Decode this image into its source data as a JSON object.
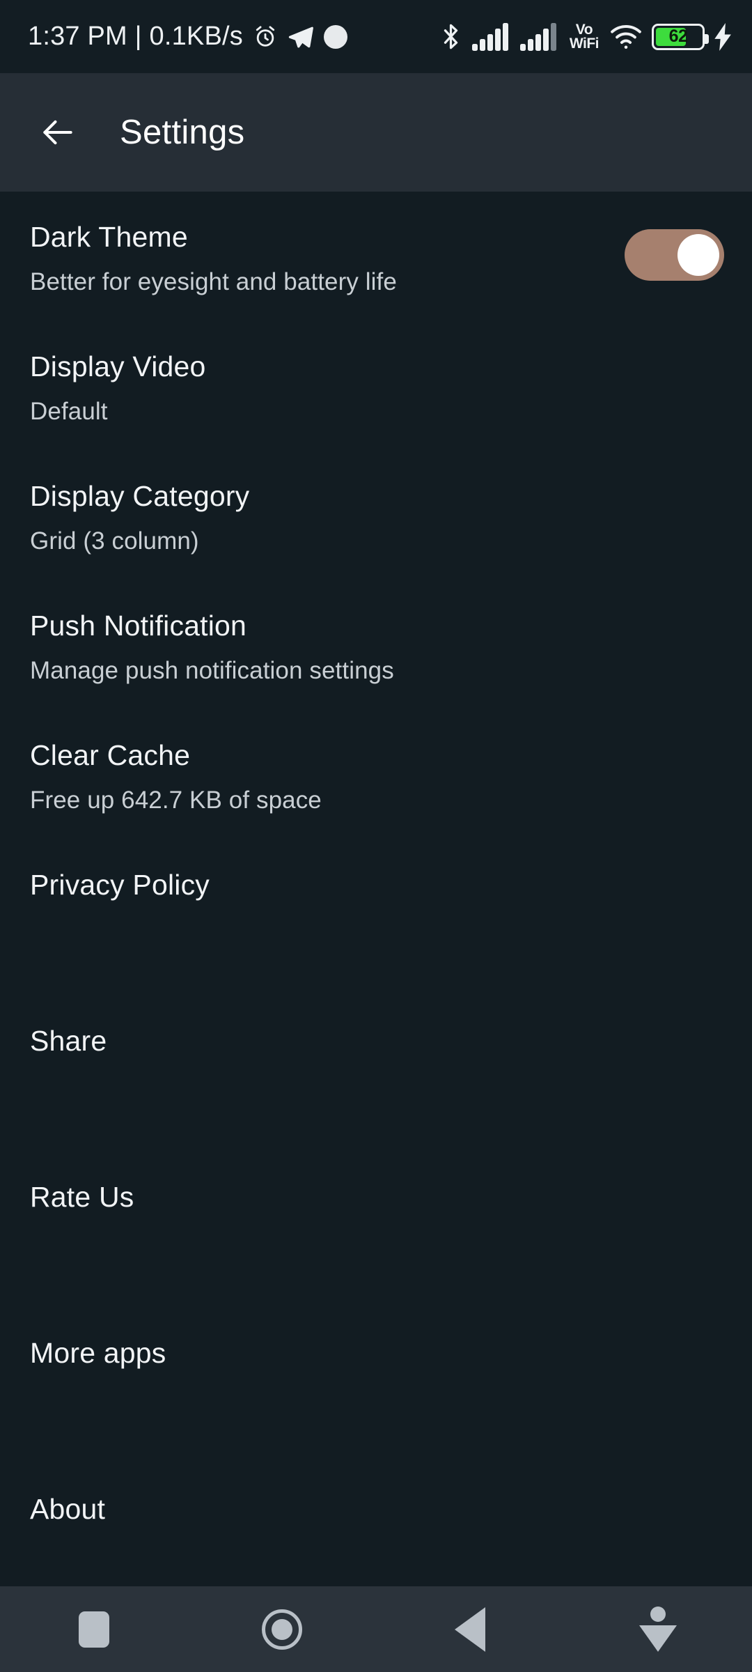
{
  "status_bar": {
    "clock_and_speed": "1:37 PM | 0.1KB/s",
    "left_icons": [
      "alarm-clock-icon",
      "telegram-icon",
      "white-dot-icon"
    ],
    "right_icons": [
      "bluetooth-icon",
      "signal-bars-sim1-icon",
      "signal-bars-sim2-icon",
      "vowifi-icon",
      "wifi-icon",
      "battery-icon",
      "charging-bolt-icon"
    ],
    "vowifi_line1": "Vo",
    "vowifi_line2": "WiFi",
    "battery_percent": "62",
    "battery_fill_color": "#3ddc3d",
    "charging": true
  },
  "appbar": {
    "back_icon": "arrow-left-icon",
    "title": "Settings",
    "background_color": "#262e36"
  },
  "settings": {
    "items": [
      {
        "title": "Dark Theme",
        "subtitle": "Better for eyesight and battery life",
        "control": "toggle",
        "toggle_on": true
      },
      {
        "title": "Display Video",
        "subtitle": "Default",
        "control": "none"
      },
      {
        "title": "Display Category",
        "subtitle": "Grid (3 column)",
        "control": "none"
      },
      {
        "title": "Push Notification",
        "subtitle": "Manage push notification settings",
        "control": "none"
      },
      {
        "title": "Clear Cache",
        "subtitle": "Free up 642.7 KB of space",
        "control": "none"
      },
      {
        "title": "Privacy Policy",
        "subtitle": "",
        "control": "none"
      },
      {
        "title": "Share",
        "subtitle": "",
        "control": "none"
      },
      {
        "title": "Rate Us",
        "subtitle": "",
        "control": "none"
      },
      {
        "title": "More apps",
        "subtitle": "",
        "control": "none"
      },
      {
        "title": "About",
        "subtitle": "",
        "control": "none"
      }
    ]
  },
  "navbar": {
    "buttons": [
      "recents-square-icon",
      "home-circle-icon",
      "back-triangle-icon",
      "pull-down-icon"
    ],
    "background_color": "#2b333b",
    "icon_color": "#b9c0c7"
  },
  "theme": {
    "page_background": "#121c22",
    "status_bar_background": "#131d23",
    "title_text_color": "#f2f4f6",
    "subtitle_text_color": "#c9cfd4",
    "toggle_track_color": "#a6806e",
    "toggle_knob_color": "#ffffff"
  }
}
